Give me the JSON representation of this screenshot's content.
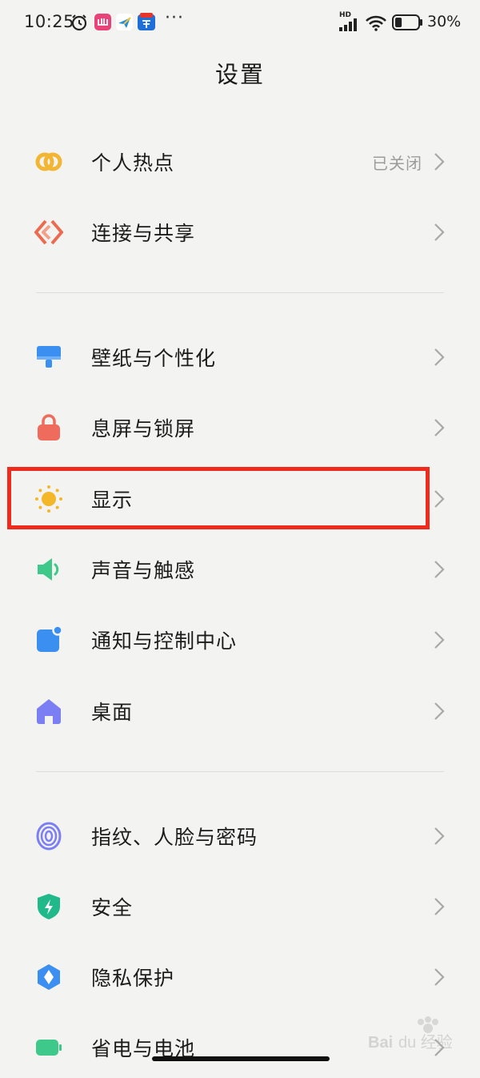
{
  "status_bar": {
    "time": "10:25",
    "network_badge": "HD",
    "battery_percent": "30%",
    "battery_level": 0.3,
    "overflow": "···",
    "icons": [
      "alarm-icon",
      "pink-app-icon",
      "plane-app-icon",
      "ticket-app-icon",
      "signal-icon",
      "wifi-icon",
      "battery-icon"
    ]
  },
  "page": {
    "title": "设置"
  },
  "items": [
    {
      "label": "个人热点",
      "value": "已关闭",
      "icon": "hotspot-link-icon",
      "color": "#f2b632"
    },
    {
      "label": "连接与共享",
      "value": "",
      "icon": "connection-share-icon",
      "color": "#ec6a4e"
    },
    {
      "label": "壁纸与个性化",
      "value": "",
      "icon": "wallpaper-brush-icon",
      "color": "#3a8ff0"
    },
    {
      "label": "息屏与锁屏",
      "value": "",
      "icon": "lock-icon",
      "color": "#ef6b5b"
    },
    {
      "label": "显示",
      "value": "",
      "icon": "sun-icon",
      "color": "#f5b72a"
    },
    {
      "label": "声音与触感",
      "value": "",
      "icon": "speaker-icon",
      "color": "#3ec98a"
    },
    {
      "label": "通知与控制中心",
      "value": "",
      "icon": "notification-icon",
      "color": "#3b8ff0"
    },
    {
      "label": "桌面",
      "value": "",
      "icon": "home-icon",
      "color": "#7b7ff3"
    },
    {
      "label": "指纹、人脸与密码",
      "value": "",
      "icon": "fingerprint-icon",
      "color": "#7b7ff3"
    },
    {
      "label": "安全",
      "value": "",
      "icon": "shield-icon",
      "color": "#21b88a"
    },
    {
      "label": "隐私保护",
      "value": "",
      "icon": "privacy-icon",
      "color": "#3b8ff0"
    },
    {
      "label": "省电与电池",
      "value": "",
      "icon": "battery-saver-icon",
      "color": "#3ec98a"
    }
  ],
  "highlight_color": "#ee2b1c",
  "watermark": "Baidu经验"
}
